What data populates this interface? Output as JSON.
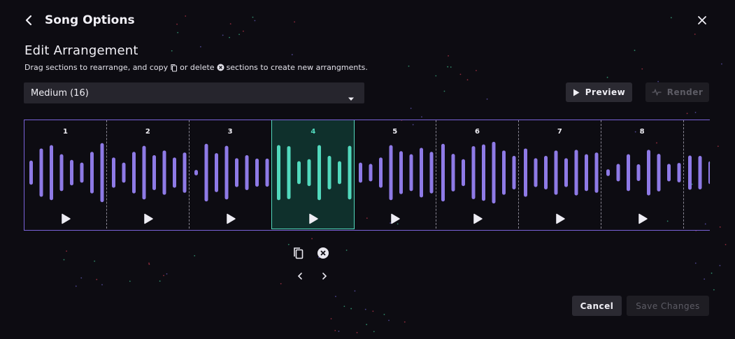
{
  "header": {
    "title": "Song Options"
  },
  "arrangement": {
    "title": "Edit Arrangement",
    "instructions": {
      "part1": "Drag sections to rearrange, and copy",
      "part2": "or delete",
      "part3": "sections to create new arrangments."
    },
    "select": {
      "value": "Medium (16)"
    },
    "preview_label": "Preview",
    "render_label": "Render"
  },
  "sections": [
    {
      "number": "1",
      "bars": [
        0.36,
        0.72,
        0.82,
        0.55,
        0.38,
        0.3,
        0.62,
        0.88,
        0.82
      ]
    },
    {
      "number": "2",
      "bars": [
        0.45,
        0.3,
        0.62,
        0.8,
        0.52,
        0.66,
        0.45,
        0.6,
        0.87
      ]
    },
    {
      "number": "3",
      "bars": [
        0.08,
        0.86,
        0.58,
        0.8,
        0.43,
        0.52,
        0.42,
        0.42,
        0.4
      ]
    },
    {
      "number": "4",
      "bars": [
        0.82,
        0.79,
        0.34,
        0.4,
        0.82,
        0.5,
        0.34,
        0.8,
        0.85
      ]
    },
    {
      "number": "5",
      "bars": [
        0.3,
        0.26,
        0.45,
        0.82,
        0.64,
        0.55,
        0.74,
        0.62,
        0.74
      ]
    },
    {
      "number": "6",
      "bars": [
        0.86,
        0.56,
        0.4,
        0.79,
        0.84,
        0.92,
        0.66,
        0.5
      ]
    },
    {
      "number": "7",
      "bars": [
        0.72,
        0.43,
        0.5,
        0.66,
        0.43,
        0.68,
        0.55,
        0.6
      ]
    },
    {
      "number": "8",
      "bars": [
        0.1,
        0.26,
        0.55,
        0.25,
        0.68,
        0.56,
        0.26,
        0.29,
        0.28
      ]
    },
    {
      "number": "",
      "bars": [
        0.51,
        0.5,
        0.34
      ]
    }
  ],
  "footer": {
    "cancel_label": "Cancel",
    "save_label": "Save Changes"
  },
  "colors": {
    "accent_purple": "#8e7ae6",
    "selected_teal": "#52d9bd",
    "selected_bg": "#0f302c",
    "background": "#0d0c12"
  }
}
